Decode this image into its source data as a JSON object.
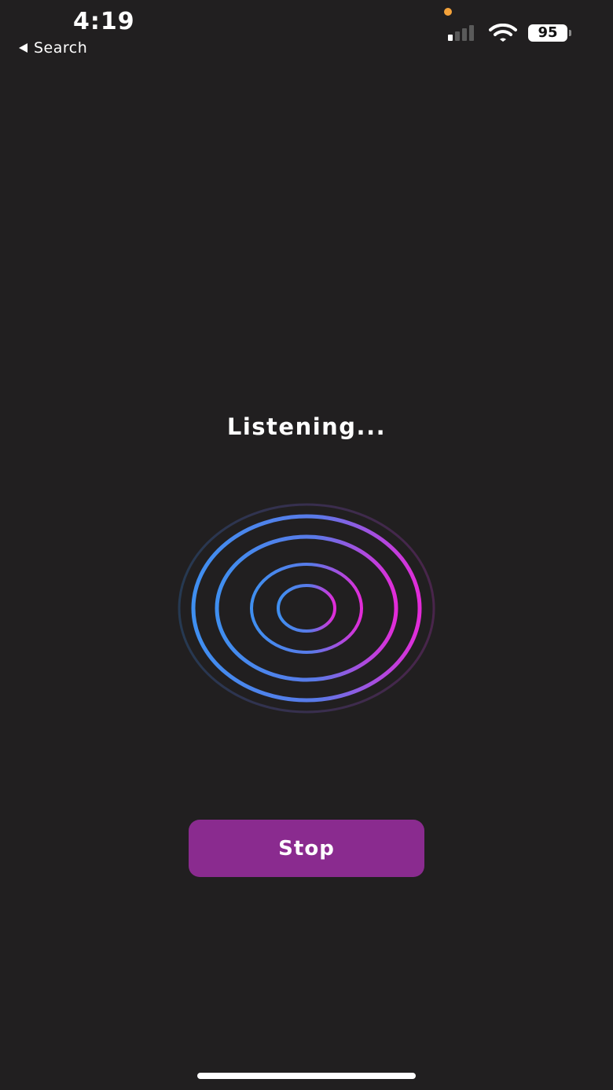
{
  "status_bar": {
    "time": "4:19",
    "back_label": "Search",
    "signal_bars_active": 1,
    "battery": "95",
    "mic_indicator_color": "#f4a23a"
  },
  "main": {
    "status_text": "Listening...",
    "stop_label": "Stop"
  },
  "colors": {
    "background": "#211f20",
    "button": "#8a2b8f",
    "ring_blue": "#3f8ff0",
    "ring_magenta": "#e32bd8"
  }
}
